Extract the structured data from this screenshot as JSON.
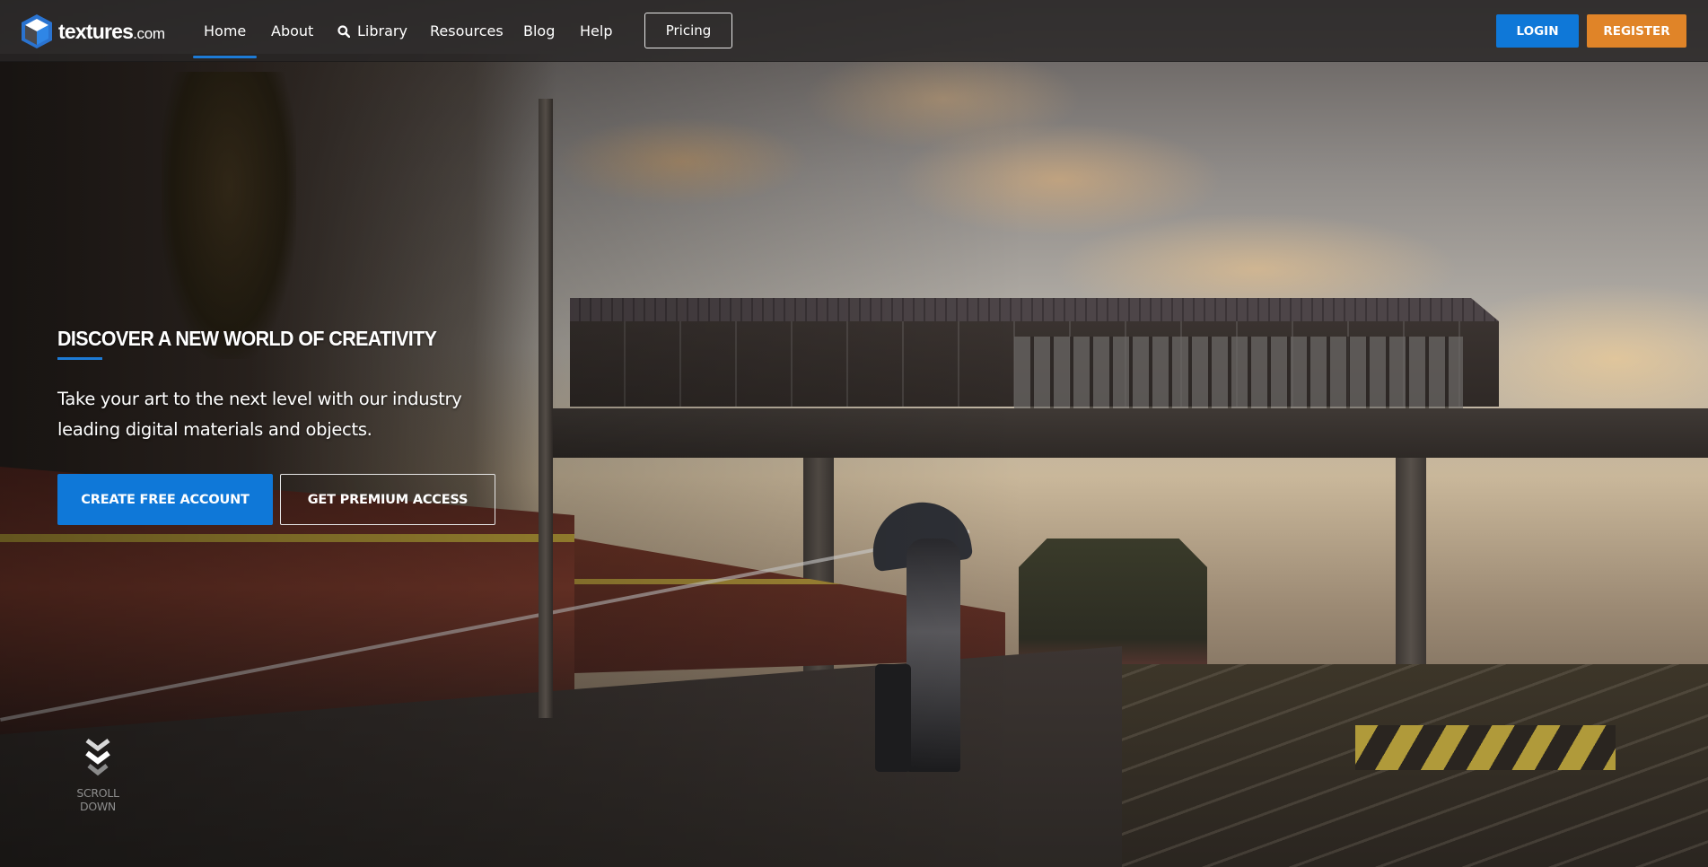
{
  "brand": {
    "name": "textures",
    "suffix": ".com",
    "colors": {
      "accent_blue": "#0f78d8",
      "register_orange": "#e08428"
    }
  },
  "nav": {
    "items": [
      {
        "label": "Home",
        "active": true
      },
      {
        "label": "About"
      },
      {
        "label": "Library",
        "icon": "search-icon"
      },
      {
        "label": "Resources"
      },
      {
        "label": "Blog"
      },
      {
        "label": "Help"
      }
    ],
    "pricing_label": "Pricing",
    "login_label": "LOGIN",
    "register_label": "REGISTER"
  },
  "hero": {
    "title": "DISCOVER A NEW WORLD OF CREATIVITY",
    "subtitle": "Take your art to the next level with our industry leading digital materials and objects.",
    "primary_cta": "CREATE FREE ACCOUNT",
    "secondary_cta": "GET PREMIUM ACCESS",
    "scroll_label": "SCROLL DOWN",
    "background_image": "rainy train station platform at dusk with footbridge, red trains and person with umbrella"
  }
}
